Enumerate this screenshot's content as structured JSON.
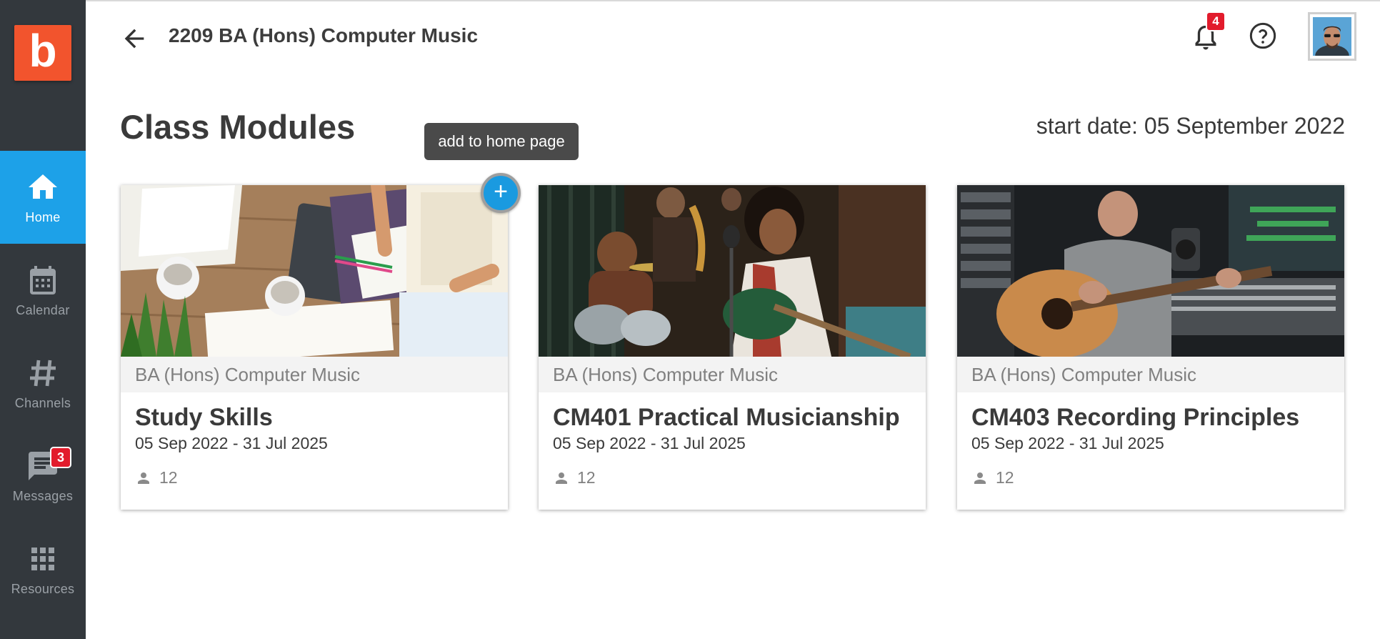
{
  "app": {
    "logo_letter": "b"
  },
  "sidebar": {
    "items": [
      {
        "label": "Home",
        "icon": "home-icon",
        "active": true
      },
      {
        "label": "Calendar",
        "icon": "calendar-icon",
        "active": false
      },
      {
        "label": "Channels",
        "icon": "hash-icon",
        "active": false
      },
      {
        "label": "Messages",
        "icon": "message-icon",
        "active": false,
        "badge": "3"
      },
      {
        "label": "Resources",
        "icon": "grid-icon",
        "active": false
      }
    ]
  },
  "header": {
    "title": "2209 BA (Hons) Computer Music",
    "notifications_count": "4"
  },
  "main": {
    "section_title": "Class Modules",
    "start_date": "start date: 05 September 2022",
    "tooltip": "add to home page",
    "add_button_label": "+",
    "cards": [
      {
        "subtitle": "BA (Hons) Computer Music",
        "title": "Study Skills",
        "dates": "05 Sep 2022 - 31 Jul 2025",
        "members": "12"
      },
      {
        "subtitle": "BA (Hons) Computer Music",
        "title": "CM401 Practical Musicianship",
        "dates": "05 Sep 2022 - 31 Jul 2025",
        "members": "12"
      },
      {
        "subtitle": "BA (Hons) Computer Music",
        "title": "CM403 Recording Principles",
        "dates": "05 Sep 2022 - 31 Jul 2025",
        "members": "12"
      }
    ]
  },
  "colors": {
    "accent": "#1da1e8",
    "sidebar": "#33383d",
    "logo": "#f2542d",
    "badge": "#e21b2c"
  }
}
